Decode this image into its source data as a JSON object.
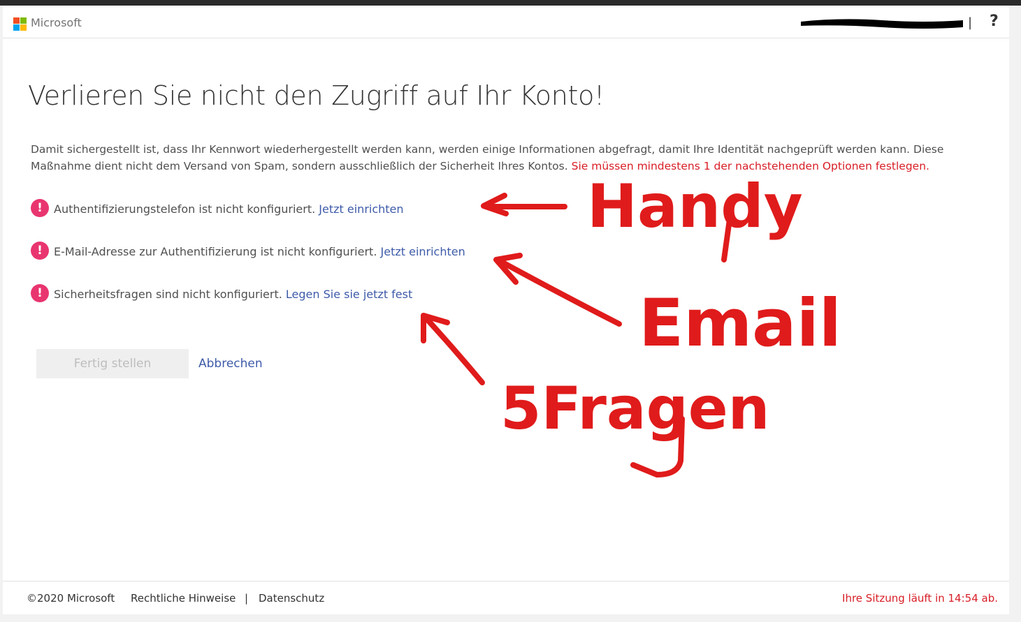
{
  "header": {
    "brand": "Microsoft",
    "separator": "|",
    "help_label": "?"
  },
  "main": {
    "title": "Verlieren Sie nicht den Zugriff auf Ihr Konto!",
    "intro_text": "Damit sichergestellt ist, dass Ihr Kennwort wiederhergestellt werden kann, werden einige Informationen abgefragt, damit Ihre Identität nachgeprüft werden kann. Diese Maßnahme dient nicht dem Versand von Spam, sondern ausschließlich der Sicherheit Ihres Kontos.",
    "intro_warning": "Sie müssen mindestens 1 der nachstehenden Optionen festlegen.",
    "requirements": [
      {
        "icon": "!",
        "text": "Authentifizierungstelefon ist nicht konfiguriert.",
        "link": "Jetzt einrichten"
      },
      {
        "icon": "!",
        "text": "E-Mail-Adresse zur Authentifizierung ist nicht konfiguriert.",
        "link": "Jetzt einrichten"
      },
      {
        "icon": "!",
        "text": "Sicherheitsfragen sind nicht konfiguriert.",
        "link": "Legen Sie sie jetzt fest"
      }
    ],
    "finish_button": "Fertig stellen",
    "cancel_link": "Abbrechen"
  },
  "annotations": {
    "handy": "Handy",
    "email": "Email",
    "fragen": "5Fragen",
    "color": "#e01b1b"
  },
  "footer": {
    "copyright": "©2020 Microsoft",
    "legal": "Rechtliche Hinweise",
    "separator": "|",
    "privacy": "Datenschutz",
    "session": "Ihre Sitzung läuft in 14:54 ab."
  },
  "colors": {
    "link": "#3e5ba9",
    "warning": "#d81e26",
    "alert_icon": "#e9356f",
    "ms_red": "#f25022",
    "ms_green": "#7fba00",
    "ms_blue": "#00a4ef",
    "ms_yellow": "#ffb900"
  }
}
